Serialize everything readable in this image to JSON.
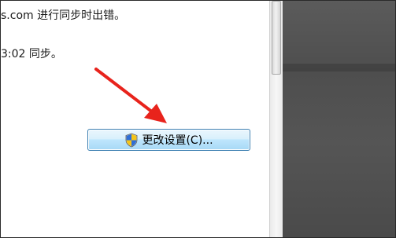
{
  "dialog": {
    "sync_error_text": "s.com 进行同步时出错。",
    "sync_time_text": "3:02 同步。",
    "change_settings_button": "更改设置(C)..."
  },
  "icons": {
    "button_icon": "uac-shield-icon",
    "annotation": "red-arrow"
  },
  "colors": {
    "arrow": "#e8231c",
    "dark_background": "#505050",
    "button_border": "#3c7fb1"
  }
}
